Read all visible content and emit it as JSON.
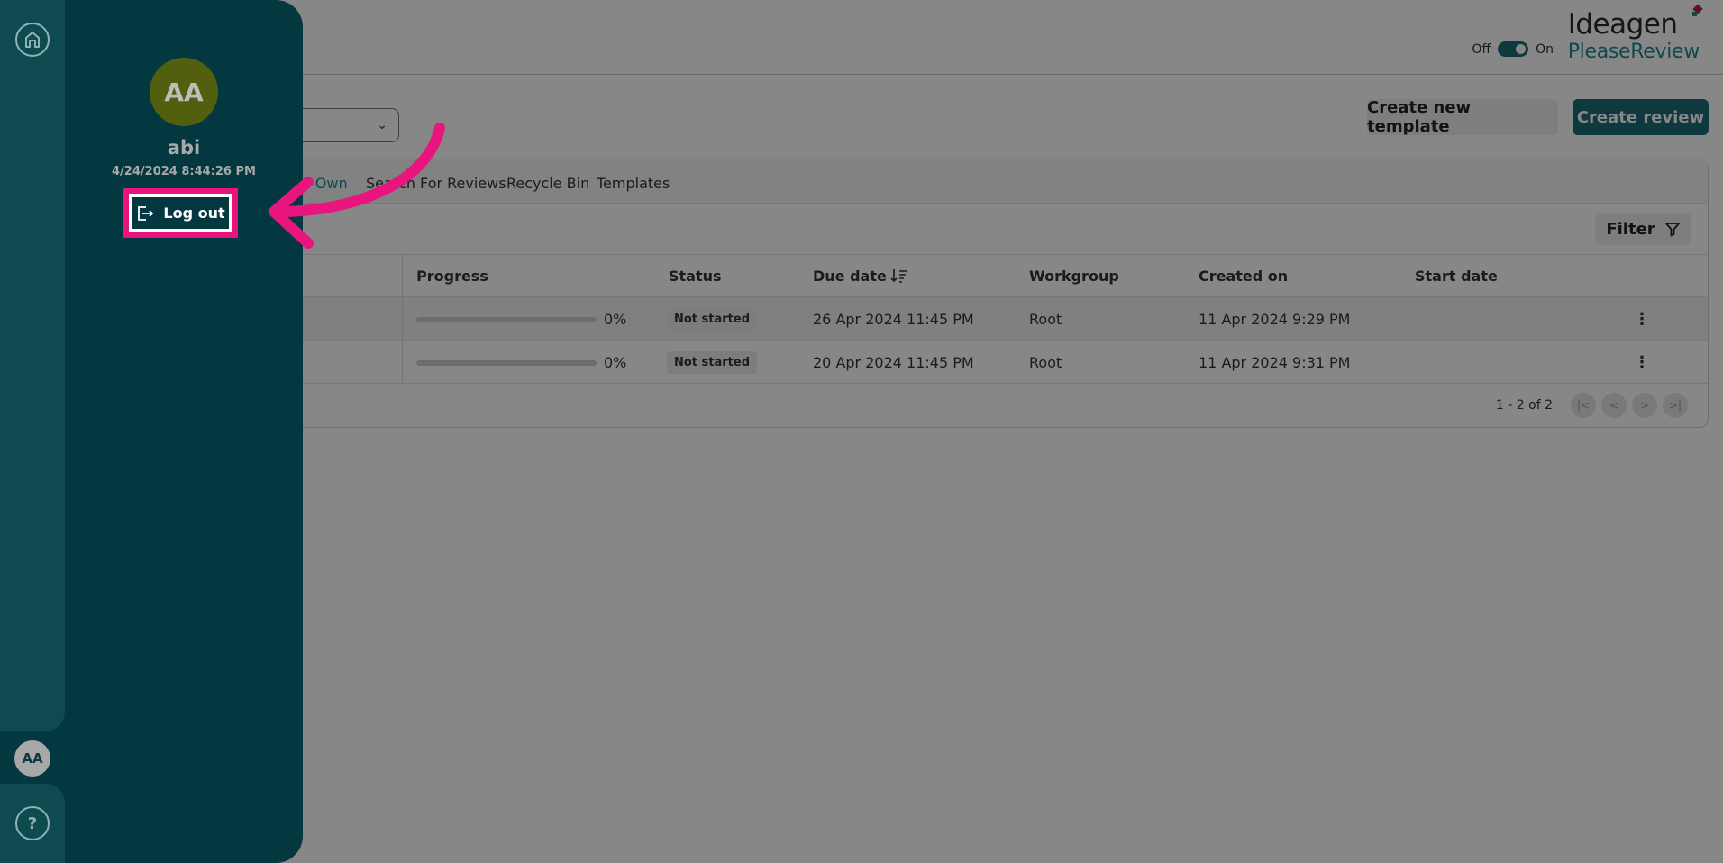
{
  "header": {
    "toggle_off_label": "Off",
    "toggle_on_label": "On",
    "brand_line1": "Ideagen",
    "brand_line2": "PleaseReview"
  },
  "actions": {
    "create_template_label": "Create new template",
    "create_review_label": "Create review"
  },
  "tabs": [
    "I Own",
    "Search For Reviews",
    "Recycle Bin",
    "Templates"
  ],
  "filter_label": "Filter",
  "table": {
    "columns": [
      "Progress",
      "Status",
      "Due date",
      "Workgroup",
      "Created on",
      "Start date"
    ],
    "rows": [
      {
        "progress": "0%",
        "status": "Not started",
        "due_date": "26 Apr 2024 11:45 PM",
        "workgroup": "Root",
        "created_on": "11 Apr 2024 9:29 PM",
        "start_date": ""
      },
      {
        "progress": "0%",
        "status": "Not started",
        "due_date": "20 Apr 2024 11:45 PM",
        "workgroup": "Root",
        "created_on": "11 Apr 2024 9:31 PM",
        "start_date": ""
      }
    ]
  },
  "pagination": {
    "range_text": "1 - 2 of 2"
  },
  "user_panel": {
    "initials": "AA",
    "name": "abi",
    "timestamp": "4/24/2024 8:44:26 PM",
    "logout_label": "Log out"
  },
  "rail": {
    "avatar_initials": "AA",
    "help_symbol": "?"
  },
  "colors": {
    "brand_teal": "#1b6f78",
    "sidebar": "#033840",
    "highlight": "#e8157f",
    "avatar_bg": "#525f0f"
  }
}
